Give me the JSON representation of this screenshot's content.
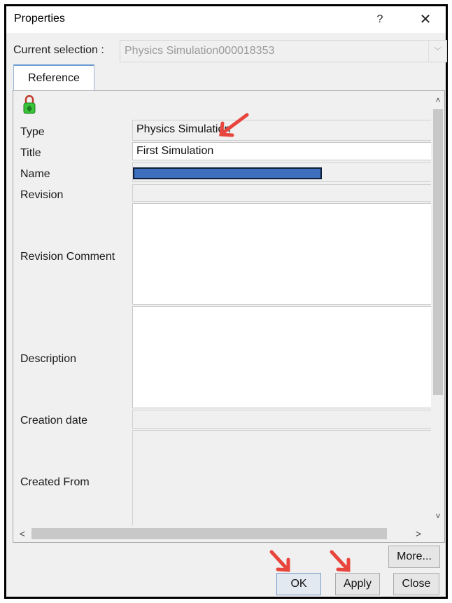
{
  "window": {
    "title": "Properties",
    "help_label": "?",
    "close_label": "✕"
  },
  "selection": {
    "label": "Current selection :",
    "value": "Physics Simulation000018353",
    "arrow": "﹀"
  },
  "tabs": [
    {
      "label": "Reference"
    }
  ],
  "fields": {
    "type": {
      "label": "Type",
      "value": "Physics Simulation"
    },
    "title": {
      "label": "Title",
      "value": "First Simulation"
    },
    "name": {
      "label": "Name",
      "value": ""
    },
    "revision": {
      "label": "Revision",
      "value": ""
    },
    "revision_comment": {
      "label": "Revision Comment",
      "value": ""
    },
    "description": {
      "label": "Description",
      "value": ""
    },
    "creation_date": {
      "label": "Creation date",
      "value": ""
    },
    "created_from": {
      "label": "Created From",
      "value": ""
    }
  },
  "scrollbars": {
    "up": "˄",
    "down": "˅",
    "left": "<",
    "right": ">"
  },
  "buttons": {
    "more": "More...",
    "ok": "OK",
    "apply": "Apply",
    "close": "Close"
  },
  "colors": {
    "annotation_arrow": "#e8453c",
    "redaction_fill": "#3d6fbd",
    "lock_icon_green": "#39c43a",
    "lock_icon_red": "#c0392b"
  }
}
